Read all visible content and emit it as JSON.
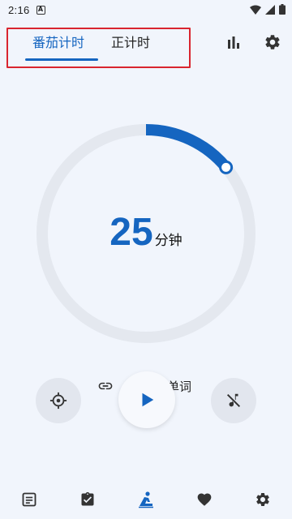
{
  "status_bar": {
    "time": "2:16",
    "notification_letter": "A"
  },
  "tabs": [
    {
      "label": "番茄计时",
      "active": true
    },
    {
      "label": "正计时",
      "active": false
    }
  ],
  "timer": {
    "minutes": "25",
    "unit": "分钟",
    "progress": 0.14
  },
  "link": {
    "text": "单词"
  },
  "colors": {
    "accent": "#1565C0",
    "ring_track": "#E4E8EF",
    "highlight_box": "#D9252F",
    "background": "#F1F5FC"
  },
  "icons": {
    "stats": "bar-chart-icon",
    "settings": "gear-icon",
    "focus": "crosshair-icon",
    "link": "link-icon",
    "play": "play-icon",
    "mute": "music-off-icon",
    "nav": [
      "notes-icon",
      "task-check-icon",
      "focus-mode-icon",
      "heart-icon",
      "gear-icon"
    ]
  },
  "bottom_nav": {
    "active_index": 2
  }
}
